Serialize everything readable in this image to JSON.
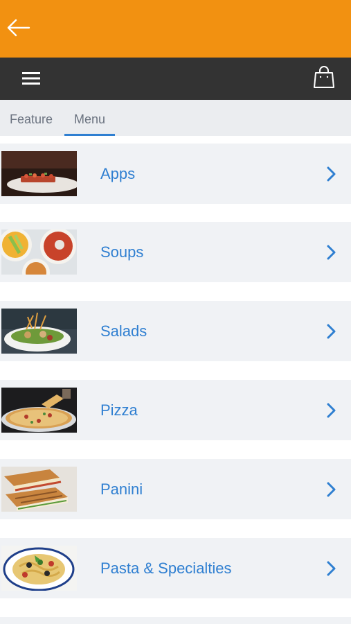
{
  "tabs": [
    {
      "label": "Feature",
      "active": false
    },
    {
      "label": "Menu",
      "active": true
    }
  ],
  "menu": [
    {
      "label": "Apps",
      "image": "appetizer-plate"
    },
    {
      "label": "Soups",
      "image": "soup-bowls"
    },
    {
      "label": "Salads",
      "image": "salad-bowl"
    },
    {
      "label": "Pizza",
      "image": "pizza"
    },
    {
      "label": "Panini",
      "image": "panini-sandwich"
    },
    {
      "label": "Pasta & Specialties",
      "image": "pasta-plate"
    }
  ],
  "colors": {
    "topbar": "#f29111",
    "navbar": "#333333",
    "tabs_bg": "#ebedf0",
    "accent": "#2f7fd1",
    "row_bg": "#f0f2f5"
  },
  "icons": {
    "back": "back-arrow-icon",
    "menu": "hamburger-menu-icon",
    "cart": "shopping-bag-icon",
    "row": "chevron-right-icon"
  }
}
